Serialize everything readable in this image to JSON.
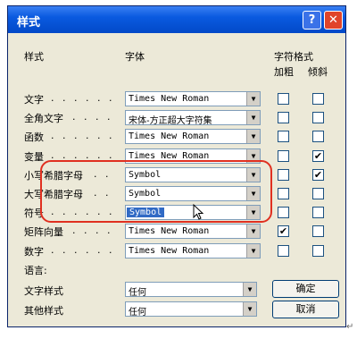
{
  "window": {
    "title": "样式",
    "help_icon": "?",
    "close_icon": "✕"
  },
  "headers": {
    "style": "样式",
    "font": "字体",
    "char_format": "字符格式",
    "bold": "加粗",
    "italic": "倾斜"
  },
  "rows": [
    {
      "label": "文字",
      "dots": ". . . . . .",
      "font": "Times New Roman",
      "bold": false,
      "italic": false
    },
    {
      "label": "全角文字",
      "dots": ". . . .",
      "font": "宋体-方正超大字符集",
      "bold": false,
      "italic": false
    },
    {
      "label": "函数",
      "dots": ". . . . . .",
      "font": "Times New Roman",
      "bold": false,
      "italic": false
    },
    {
      "label": "变量",
      "dots": ". . . . . .",
      "font": "Times New Roman",
      "bold": false,
      "italic": true
    },
    {
      "label": "小写希腊字母",
      "dots": ". .",
      "font": "Symbol",
      "bold": false,
      "italic": true
    },
    {
      "label": "大写希腊字母",
      "dots": ". .",
      "font": "Symbol",
      "bold": false,
      "italic": false
    },
    {
      "label": "符号",
      "dots": ". . . . . .",
      "font": "Symbol",
      "bold": false,
      "italic": false
    },
    {
      "label": "矩阵向量",
      "dots": ". . . .",
      "font": "Times New Roman",
      "bold": true,
      "italic": false
    },
    {
      "label": "数字",
      "dots": ". . . . . .",
      "font": "Times New Roman",
      "bold": false,
      "italic": false
    }
  ],
  "language": {
    "heading": "语言:",
    "text_style_label": "文字样式",
    "text_style_value": "任何",
    "other_style_label": "其他样式",
    "other_style_value": "任何"
  },
  "buttons": {
    "ok": "确定",
    "cancel": "取消"
  },
  "icons": {
    "dropdown": "▼",
    "check": "✔",
    "return_mark": "↵"
  },
  "colors": {
    "titlebar": "#0a5ae0",
    "highlight_oval": "#e03020",
    "selection": "#316ac5"
  }
}
